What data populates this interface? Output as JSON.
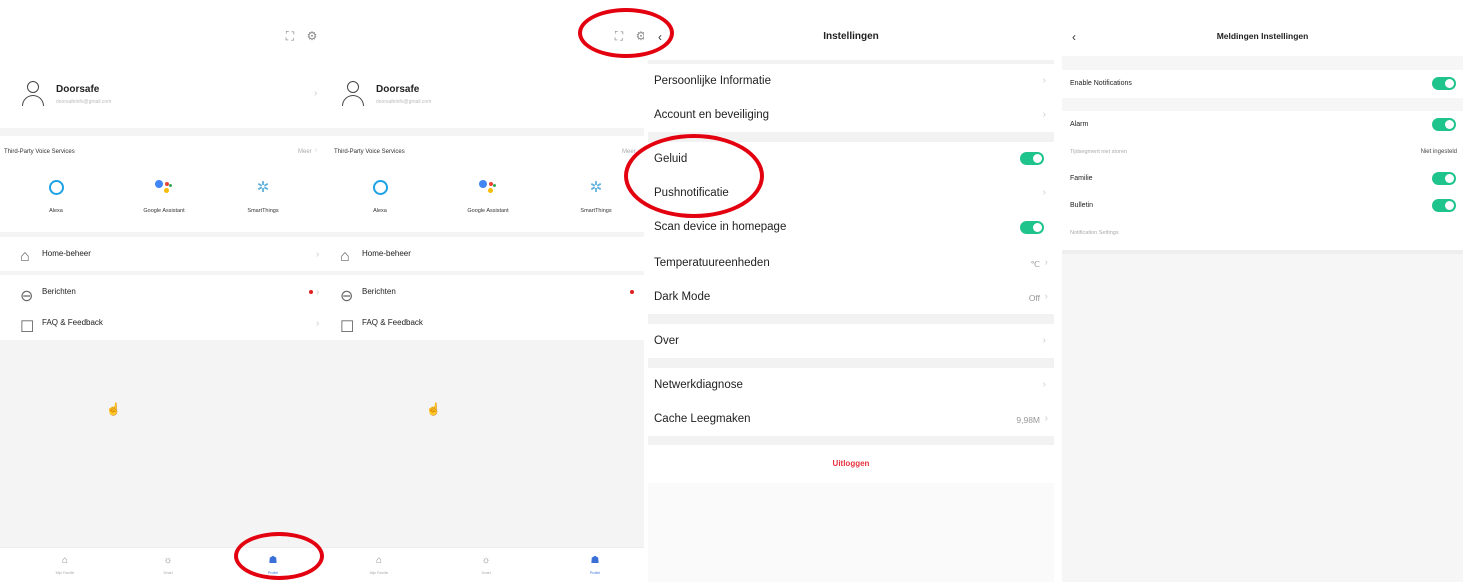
{
  "profile": {
    "user_name": "Doorsafe",
    "user_email": "doorsafeinfo@gmail.com",
    "voice_title": "Third-Party Voice Services",
    "voice_more": "Meer",
    "voice_more_short": "Meer",
    "services": [
      {
        "label": "Alexa",
        "icon": "alexa-icon"
      },
      {
        "label": "Google Assistant",
        "icon": "google-assistant-icon"
      },
      {
        "label": "SmartThings",
        "icon": "smartthings-icon"
      }
    ],
    "menu": [
      {
        "label": "Home-beheer",
        "icon": "home-icon"
      },
      {
        "label": "Berichten",
        "icon": "message-icon"
      },
      {
        "label": "FAQ & Feedback",
        "icon": "faq-icon"
      }
    ],
    "tabs": [
      {
        "label": "Mijn Familie",
        "icon": "home-tab-icon"
      },
      {
        "label": "Smart",
        "icon": "smart-tab-icon"
      },
      {
        "label": "Profiel",
        "icon": "profile-tab-icon"
      }
    ],
    "icons": {
      "scan": "scan-icon",
      "settings": "gear-icon"
    }
  },
  "settings": {
    "title": "Instellingen",
    "rows": [
      {
        "label": "Persoonlijke Informatie"
      },
      {
        "label": "Account en beveiliging"
      },
      {
        "label": "Geluid",
        "toggle": true
      },
      {
        "label": "Pushnotificatie"
      },
      {
        "label": "Scan device in homepage",
        "toggle": true
      },
      {
        "label": "Temperatuureenheden",
        "value": "℃"
      },
      {
        "label": "Dark Mode",
        "value": "Off"
      },
      {
        "label": "Over"
      },
      {
        "label": "Netwerkdiagnose"
      },
      {
        "label": "Cache Leegmaken",
        "value": "9,98M"
      }
    ],
    "logout": "Uitloggen"
  },
  "notifications": {
    "title": "Meldingen Instellingen",
    "enable": "Enable Notifications",
    "alarm": "Alarm",
    "dnd_label": "Tijdsegment niet storen",
    "dnd_value": "Niet ingesteld",
    "familie": "Familie",
    "bulletin": "Bulletin",
    "notification_settings": "Notification Settings"
  },
  "colors": {
    "accent_green": "#1fc48d",
    "logout_red": "#e8313f",
    "highlight_red": "#e3000f",
    "active_tab_blue": "#3a6fd8"
  }
}
